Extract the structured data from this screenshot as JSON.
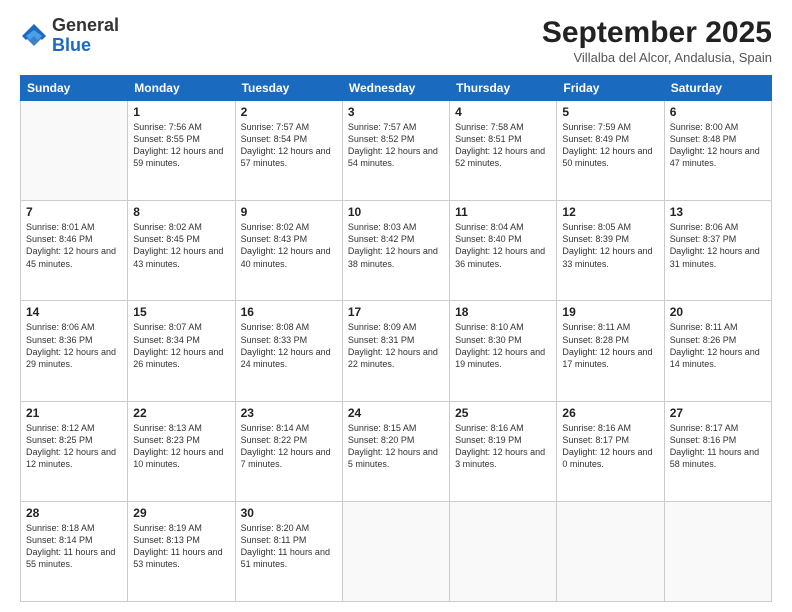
{
  "header": {
    "logo_general": "General",
    "logo_blue": "Blue",
    "month": "September 2025",
    "location": "Villalba del Alcor, Andalusia, Spain"
  },
  "days_of_week": [
    "Sunday",
    "Monday",
    "Tuesday",
    "Wednesday",
    "Thursday",
    "Friday",
    "Saturday"
  ],
  "weeks": [
    [
      {
        "day": "",
        "sunrise": "",
        "sunset": "",
        "daylight": ""
      },
      {
        "day": "1",
        "sunrise": "Sunrise: 7:56 AM",
        "sunset": "Sunset: 8:55 PM",
        "daylight": "Daylight: 12 hours and 59 minutes."
      },
      {
        "day": "2",
        "sunrise": "Sunrise: 7:57 AM",
        "sunset": "Sunset: 8:54 PM",
        "daylight": "Daylight: 12 hours and 57 minutes."
      },
      {
        "day": "3",
        "sunrise": "Sunrise: 7:57 AM",
        "sunset": "Sunset: 8:52 PM",
        "daylight": "Daylight: 12 hours and 54 minutes."
      },
      {
        "day": "4",
        "sunrise": "Sunrise: 7:58 AM",
        "sunset": "Sunset: 8:51 PM",
        "daylight": "Daylight: 12 hours and 52 minutes."
      },
      {
        "day": "5",
        "sunrise": "Sunrise: 7:59 AM",
        "sunset": "Sunset: 8:49 PM",
        "daylight": "Daylight: 12 hours and 50 minutes."
      },
      {
        "day": "6",
        "sunrise": "Sunrise: 8:00 AM",
        "sunset": "Sunset: 8:48 PM",
        "daylight": "Daylight: 12 hours and 47 minutes."
      }
    ],
    [
      {
        "day": "7",
        "sunrise": "Sunrise: 8:01 AM",
        "sunset": "Sunset: 8:46 PM",
        "daylight": "Daylight: 12 hours and 45 minutes."
      },
      {
        "day": "8",
        "sunrise": "Sunrise: 8:02 AM",
        "sunset": "Sunset: 8:45 PM",
        "daylight": "Daylight: 12 hours and 43 minutes."
      },
      {
        "day": "9",
        "sunrise": "Sunrise: 8:02 AM",
        "sunset": "Sunset: 8:43 PM",
        "daylight": "Daylight: 12 hours and 40 minutes."
      },
      {
        "day": "10",
        "sunrise": "Sunrise: 8:03 AM",
        "sunset": "Sunset: 8:42 PM",
        "daylight": "Daylight: 12 hours and 38 minutes."
      },
      {
        "day": "11",
        "sunrise": "Sunrise: 8:04 AM",
        "sunset": "Sunset: 8:40 PM",
        "daylight": "Daylight: 12 hours and 36 minutes."
      },
      {
        "day": "12",
        "sunrise": "Sunrise: 8:05 AM",
        "sunset": "Sunset: 8:39 PM",
        "daylight": "Daylight: 12 hours and 33 minutes."
      },
      {
        "day": "13",
        "sunrise": "Sunrise: 8:06 AM",
        "sunset": "Sunset: 8:37 PM",
        "daylight": "Daylight: 12 hours and 31 minutes."
      }
    ],
    [
      {
        "day": "14",
        "sunrise": "Sunrise: 8:06 AM",
        "sunset": "Sunset: 8:36 PM",
        "daylight": "Daylight: 12 hours and 29 minutes."
      },
      {
        "day": "15",
        "sunrise": "Sunrise: 8:07 AM",
        "sunset": "Sunset: 8:34 PM",
        "daylight": "Daylight: 12 hours and 26 minutes."
      },
      {
        "day": "16",
        "sunrise": "Sunrise: 8:08 AM",
        "sunset": "Sunset: 8:33 PM",
        "daylight": "Daylight: 12 hours and 24 minutes."
      },
      {
        "day": "17",
        "sunrise": "Sunrise: 8:09 AM",
        "sunset": "Sunset: 8:31 PM",
        "daylight": "Daylight: 12 hours and 22 minutes."
      },
      {
        "day": "18",
        "sunrise": "Sunrise: 8:10 AM",
        "sunset": "Sunset: 8:30 PM",
        "daylight": "Daylight: 12 hours and 19 minutes."
      },
      {
        "day": "19",
        "sunrise": "Sunrise: 8:11 AM",
        "sunset": "Sunset: 8:28 PM",
        "daylight": "Daylight: 12 hours and 17 minutes."
      },
      {
        "day": "20",
        "sunrise": "Sunrise: 8:11 AM",
        "sunset": "Sunset: 8:26 PM",
        "daylight": "Daylight: 12 hours and 14 minutes."
      }
    ],
    [
      {
        "day": "21",
        "sunrise": "Sunrise: 8:12 AM",
        "sunset": "Sunset: 8:25 PM",
        "daylight": "Daylight: 12 hours and 12 minutes."
      },
      {
        "day": "22",
        "sunrise": "Sunrise: 8:13 AM",
        "sunset": "Sunset: 8:23 PM",
        "daylight": "Daylight: 12 hours and 10 minutes."
      },
      {
        "day": "23",
        "sunrise": "Sunrise: 8:14 AM",
        "sunset": "Sunset: 8:22 PM",
        "daylight": "Daylight: 12 hours and 7 minutes."
      },
      {
        "day": "24",
        "sunrise": "Sunrise: 8:15 AM",
        "sunset": "Sunset: 8:20 PM",
        "daylight": "Daylight: 12 hours and 5 minutes."
      },
      {
        "day": "25",
        "sunrise": "Sunrise: 8:16 AM",
        "sunset": "Sunset: 8:19 PM",
        "daylight": "Daylight: 12 hours and 3 minutes."
      },
      {
        "day": "26",
        "sunrise": "Sunrise: 8:16 AM",
        "sunset": "Sunset: 8:17 PM",
        "daylight": "Daylight: 12 hours and 0 minutes."
      },
      {
        "day": "27",
        "sunrise": "Sunrise: 8:17 AM",
        "sunset": "Sunset: 8:16 PM",
        "daylight": "Daylight: 11 hours and 58 minutes."
      }
    ],
    [
      {
        "day": "28",
        "sunrise": "Sunrise: 8:18 AM",
        "sunset": "Sunset: 8:14 PM",
        "daylight": "Daylight: 11 hours and 55 minutes."
      },
      {
        "day": "29",
        "sunrise": "Sunrise: 8:19 AM",
        "sunset": "Sunset: 8:13 PM",
        "daylight": "Daylight: 11 hours and 53 minutes."
      },
      {
        "day": "30",
        "sunrise": "Sunrise: 8:20 AM",
        "sunset": "Sunset: 8:11 PM",
        "daylight": "Daylight: 11 hours and 51 minutes."
      },
      {
        "day": "",
        "sunrise": "",
        "sunset": "",
        "daylight": ""
      },
      {
        "day": "",
        "sunrise": "",
        "sunset": "",
        "daylight": ""
      },
      {
        "day": "",
        "sunrise": "",
        "sunset": "",
        "daylight": ""
      },
      {
        "day": "",
        "sunrise": "",
        "sunset": "",
        "daylight": ""
      }
    ]
  ]
}
